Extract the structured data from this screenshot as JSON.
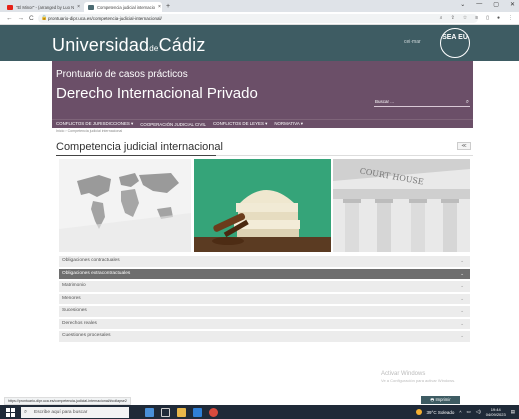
{
  "browser": {
    "tabs": [
      {
        "label": "\"El Minor\" - (arranged by Luo N",
        "icon": "youtube-icon",
        "color": "#e62117"
      },
      {
        "label": "Competencia judicial internacio",
        "icon": "uca-favicon-icon",
        "color": "#4b6b72"
      }
    ],
    "new_tab": "+",
    "window_controls": [
      "⌄",
      "—",
      "▢",
      "✕"
    ],
    "url": "prontuario-dipr.uca.es/competencia-judicial-internacional/"
  },
  "site": {
    "university_main": "Universidad",
    "university_de": "de",
    "university_city": "Cádiz",
    "campus_label": "cei·mar",
    "seal_text": "SEA EU"
  },
  "banner": {
    "title_small": "Prontuario de casos prácticos",
    "title_large": "Derecho Internacional Privado",
    "search_placeholder": "Buscar ..."
  },
  "menu": {
    "items": [
      "CONFLICTOS DE JURISDICCIONES ▾",
      "COOPERACIÓN JUDICIAL CIVIL",
      "CONFLICTOS DE LEYES ▾",
      "NORMATIVA ▾"
    ]
  },
  "breadcrumb": "Inicio › Competencia judicial internacional",
  "page": {
    "title": "Competencia judicial internacional",
    "share": "≪"
  },
  "images": {
    "court_inscription": "COURT HOUSE"
  },
  "accordion": {
    "items": [
      {
        "label": "Obligaciones contractuales",
        "active": false
      },
      {
        "label": "Obligaciones extracontractuales",
        "active": true
      },
      {
        "label": "Matrimonio",
        "active": false
      },
      {
        "label": "Menores",
        "active": false
      },
      {
        "label": "Sucesiones",
        "active": false
      },
      {
        "label": "Derechos reales",
        "active": false
      },
      {
        "label": "Cuestiones procesales",
        "active": false
      }
    ],
    "chevron": "⌄"
  },
  "windows_activation": {
    "title": "Activar Windows",
    "subtitle": "Ve a Configuración para activar Windows."
  },
  "status_url": "https://prontuario-dipr.uca.es/competencia-judicial-internacional/#collapse2",
  "print_button": "🖶 Imprimir",
  "taskbar": {
    "search_placeholder": "Escribe aquí para buscar",
    "weather": "39°C  Soleado",
    "time": "19:44",
    "date": "04/09/2023"
  }
}
